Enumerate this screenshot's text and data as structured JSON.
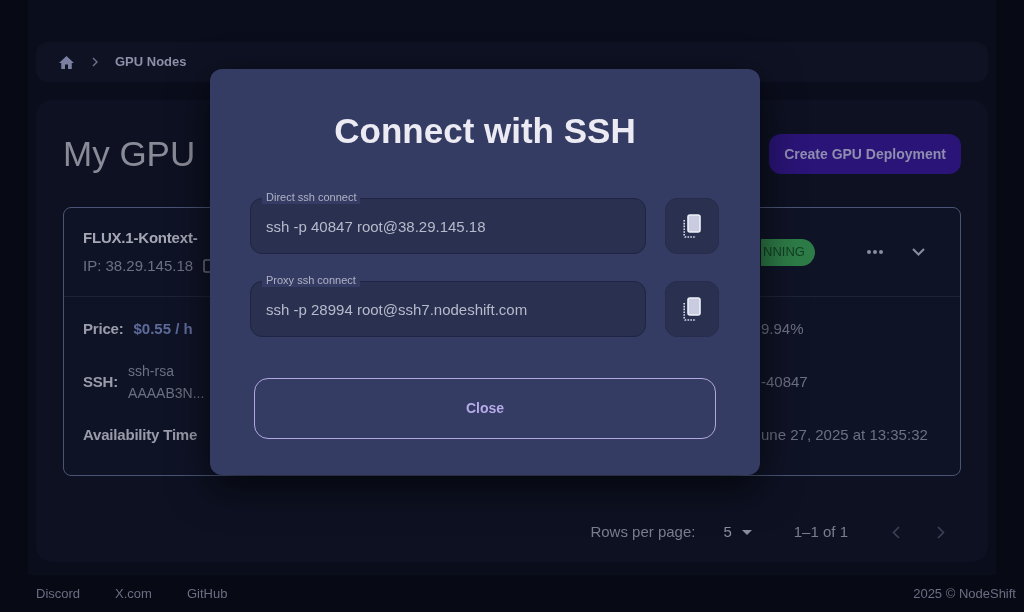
{
  "breadcrumb": {
    "current": "GPU Nodes"
  },
  "page_title": "My GPU",
  "create_button": "Create GPU Deployment",
  "node_card": {
    "name": "FLUX.1-Kontext-",
    "ip": "IP: 38.29.145.18",
    "status": "NNING",
    "rows": [
      {
        "kind": "value",
        "label": "Price:",
        "value": "$0.55 / h",
        "column_2": "9.94%"
      },
      {
        "kind": "lines",
        "label": "SSH:",
        "lines": [
          "ssh-rsa",
          "AAAAB3N..."
        ],
        "column_2": "-40847"
      },
      {
        "kind": "label",
        "label": "Availability Time",
        "column_2": "une 27, 2025 at 13:35:32"
      }
    ]
  },
  "pagination": {
    "rows_label": "Rows per page:",
    "rows_value": "5",
    "range": "1–1 of 1"
  },
  "footer": {
    "links": [
      "Discord",
      "X.com",
      "GitHub"
    ],
    "copyright": "2025 © NodeShift"
  },
  "dialog": {
    "title": "Connect with SSH",
    "fields": [
      {
        "label": "Direct ssh connect",
        "value": "ssh -p 40847 root@38.29.145.18"
      },
      {
        "label": "Proxy ssh connect",
        "value": "ssh -p 28994 root@ssh7.nodeshift.com"
      }
    ],
    "close_button": "Close"
  }
}
